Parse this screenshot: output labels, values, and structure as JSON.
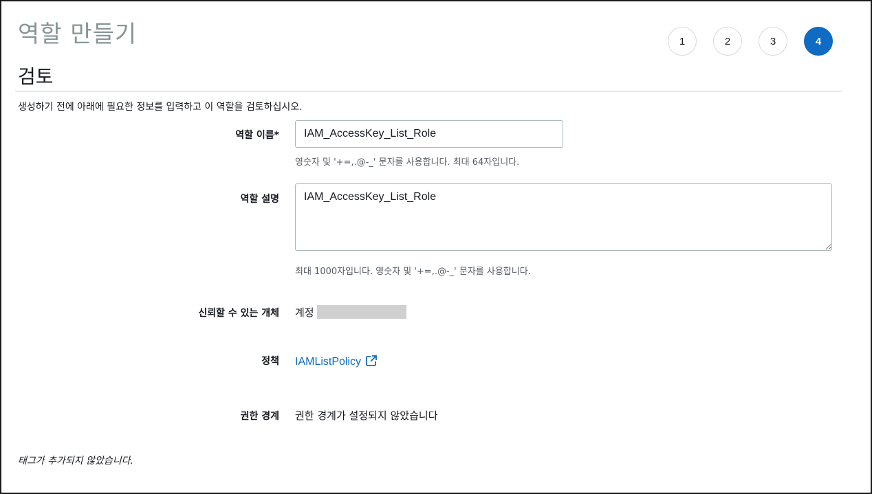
{
  "wizard": {
    "title": "역할 만들기",
    "steps": [
      {
        "label": "1",
        "active": false
      },
      {
        "label": "2",
        "active": false
      },
      {
        "label": "3",
        "active": false
      },
      {
        "label": "4",
        "active": true
      }
    ]
  },
  "section": {
    "title": "검토",
    "intro": "생성하기 전에 아래에 필요한 정보를 입력하고 이 역할을 검토하십시오."
  },
  "role_name": {
    "label": "역할 이름*",
    "value": "IAM_AccessKey_List_Role",
    "hint": "영숫자 및 '+=,.@-_' 문자를 사용합니다. 최대 64자입니다."
  },
  "role_description": {
    "label": "역할 설명",
    "value": "IAM_AccessKey_List_Role",
    "hint": "최대 1000자입니다. 영숫자 및 '+=,.@-_' 문자를 사용합니다."
  },
  "trusted_entity": {
    "label": "신뢰할 수 있는 개체",
    "value": "계정"
  },
  "policy": {
    "label": "정책",
    "link_text": "IAMListPolicy",
    "icon": "external-link-icon"
  },
  "permissions_boundary": {
    "label": "권한 경계",
    "value": "권한 경계가 설정되지 않았습니다"
  },
  "tags_note": "태그가 추가되지 않았습니다.",
  "colors": {
    "accent": "#0f6bc4",
    "muted_title": "#879596",
    "text": "#16191f",
    "hint": "#545b64",
    "redaction": "#d0d0d0"
  }
}
